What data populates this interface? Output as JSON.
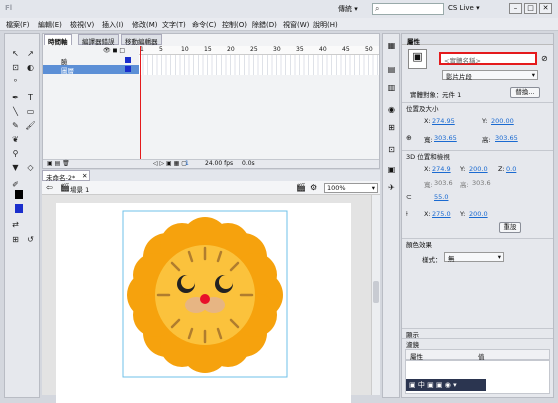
{
  "app": {
    "logo": "Fl",
    "workspace": "傳統 ▾",
    "search_placeholder": "",
    "cslive": "CS Live ▾",
    "win_min": "–",
    "win_max": "□",
    "win_close": "✕"
  },
  "menu": [
    "檔案(F)",
    "編輯(E)",
    "檢視(V)",
    "插入(I)",
    "修改(M)",
    "文字(T)",
    "命令(C)",
    "控制(O)",
    "除錯(D)",
    "視窗(W)",
    "說明(H)"
  ],
  "timeline": {
    "tabs": [
      "時間軸",
      "編譯器錯誤",
      "移動編輯器"
    ],
    "ruler": [
      "1",
      "5",
      "10",
      "15",
      "20",
      "25",
      "30",
      "35",
      "40",
      "45",
      "50"
    ],
    "layers": [
      "臉",
      "圖層"
    ],
    "status_frame": "1",
    "status_fps": "24.00 fps",
    "status_time": "0.0s"
  },
  "document": {
    "tab": "未命名-2*",
    "close": "✕",
    "scene": "場景 1",
    "zoom": "100%"
  },
  "properties": {
    "title": "屬性",
    "instance_name_placeholder": "<實體名稱>",
    "symbol_type": "影片片段",
    "instance_of_label": "實體對象：",
    "instance_of_value": "元件 1",
    "swap_button": "替換...",
    "pos_section": "位置及大小",
    "x_label": "X:",
    "x_value": "274.95",
    "y_label": "Y:",
    "y_value": "200.00",
    "w_label": "寬:",
    "w_value": "303.65",
    "h_label": "高:",
    "h_value": "303.65",
    "three_d_section": "3D 位置和檢視",
    "x3d_label": "X:",
    "x3d_value": "274.9",
    "y3d_label": "Y:",
    "y3d_value": "200.0",
    "z3d_label": "Z:",
    "z3d_value": "0.0",
    "w3d_label": "寬:",
    "w3d_value": "303.6",
    "h3d_label": "高:",
    "h3d_value": "303.6",
    "fov_value": "55.0",
    "vx_label": "X:",
    "vx_value": "275.0",
    "vy_label": "Y:",
    "vy_value": "200.0",
    "reset_button": "重設",
    "color_section": "顏色效果",
    "style_label": "樣式：",
    "style_value": "無",
    "display_section": "顯示",
    "filters_section": "濾鏡",
    "filters_col1": "屬性",
    "filters_col2": "值"
  },
  "colors": {
    "petal": "#f6a20d",
    "face": "#fbc23c",
    "nose": "#e8102a",
    "muzzle": "#e7b583",
    "whisker": "#b07d2e",
    "accent": "#1a6ad1",
    "highlight": "#e41a1c"
  }
}
